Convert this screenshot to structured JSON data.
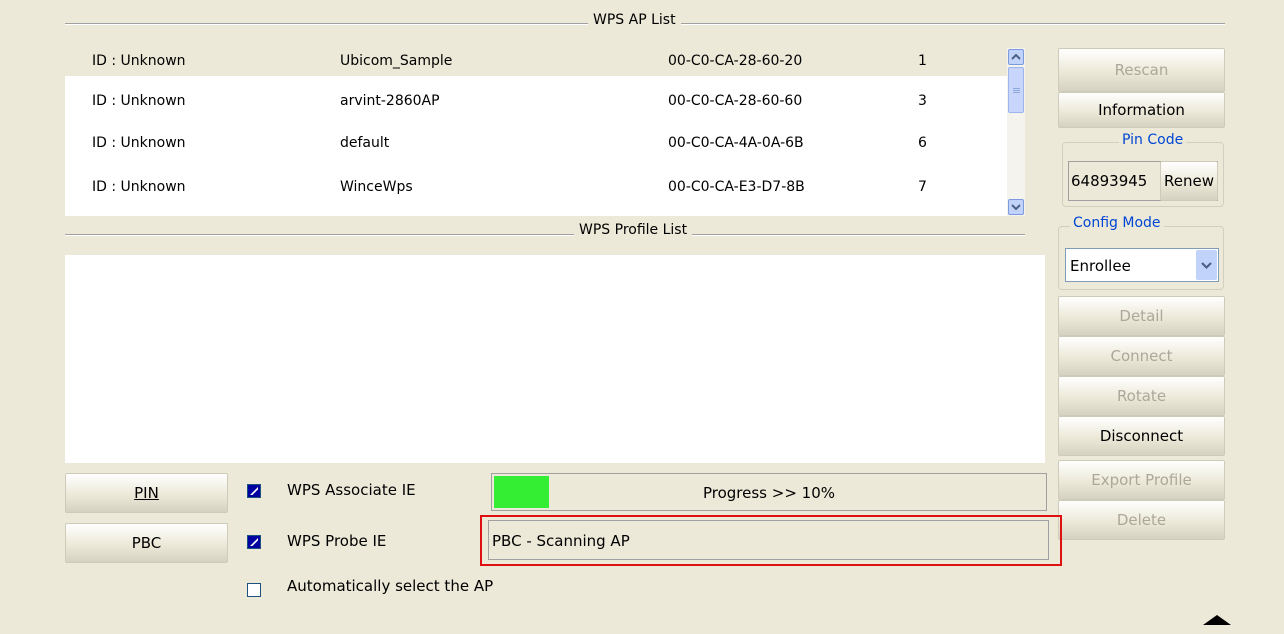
{
  "ap_list": {
    "title": "WPS AP List",
    "rows": [
      {
        "id": "ID : Unknown",
        "ssid": "Ubicom_Sample",
        "mac": "00-C0-CA-28-60-20",
        "channel": "1",
        "locked": false
      },
      {
        "id": "ID : Unknown",
        "ssid": "arvint-2860AP",
        "mac": "00-C0-CA-28-60-60",
        "channel": "3",
        "locked": true
      },
      {
        "id": "ID : Unknown",
        "ssid": "default",
        "mac": "00-C0-CA-4A-0A-6B",
        "channel": "6",
        "locked": true
      },
      {
        "id": "ID : Unknown",
        "ssid": "WinceWps",
        "mac": "00-C0-CA-E3-D7-8B",
        "channel": "7",
        "locked": true
      }
    ]
  },
  "profile_list": {
    "title": "WPS Profile List"
  },
  "side": {
    "rescan": "Rescan",
    "information": "Information",
    "pin_code_legend": "Pin Code",
    "pin_code": "64893945",
    "renew": "Renew",
    "config_mode_legend": "Config Mode",
    "config_mode_value": "Enrollee",
    "detail": "Detail",
    "connect": "Connect",
    "rotate": "Rotate",
    "disconnect": "Disconnect",
    "export_profile": "Export Profile",
    "delete": "Delete"
  },
  "bottom": {
    "pin_button": "PIN",
    "pbc_button": "PBC",
    "wps_associate_ie": "WPS Associate IE",
    "wps_probe_ie": "WPS Probe IE",
    "auto_select": "Automatically select the AP",
    "progress_text": "Progress >> 10%",
    "progress_value": 0.1,
    "status_text": "PBC - Scanning AP"
  },
  "icons": [
    "lock-icon",
    "scroll-up-icon",
    "scroll-down-icon",
    "dropdown-arrow-icon",
    "collapse-arrow-icon"
  ],
  "colors": {
    "progress_fill": "#33ee33",
    "highlight": "#e01010",
    "legend_text": "#0046d5"
  }
}
